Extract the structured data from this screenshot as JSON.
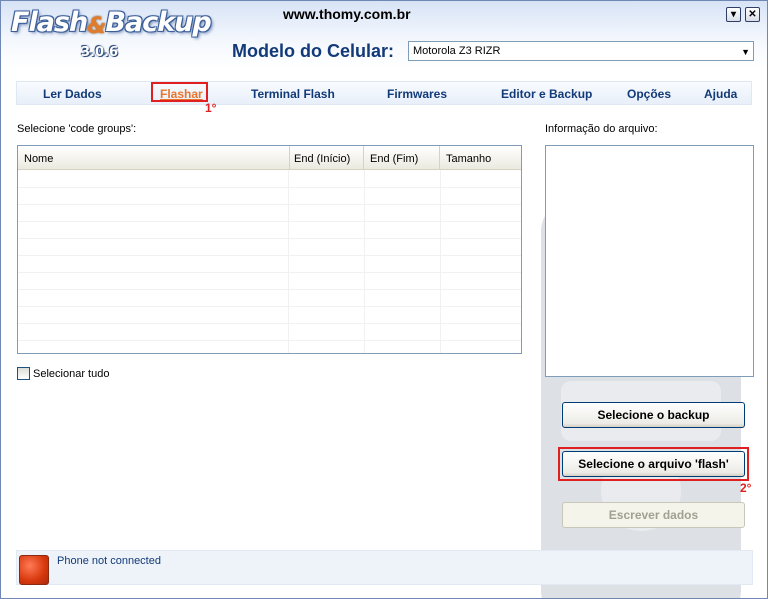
{
  "app": {
    "logo_text": "Flash&Backup",
    "version": "3.0.6",
    "site_url": "www.thomy.com.br"
  },
  "window_controls": {
    "minimize": "▾",
    "close": "✕"
  },
  "model": {
    "label": "Modelo do Celular:",
    "selected": "Motorola Z3 RIZR"
  },
  "tabs": [
    {
      "label": "Ler Dados",
      "active": false
    },
    {
      "label": "Flashar",
      "active": true
    },
    {
      "label": "Terminal Flash",
      "active": false
    },
    {
      "label": "Firmwares",
      "active": false
    },
    {
      "label": "Editor e Backup",
      "active": false
    },
    {
      "label": "Opções",
      "active": false
    },
    {
      "label": "Ajuda",
      "active": false
    }
  ],
  "annotations": {
    "step1": "1°",
    "step2": "2°",
    "color": "#e02020"
  },
  "code_groups": {
    "label": "Selecione 'code groups':",
    "columns": [
      "Nome",
      "End (Início)",
      "End (Fim)",
      "Tamanho"
    ],
    "rows": []
  },
  "select_all": {
    "label": "Selecionar tudo",
    "checked": false
  },
  "file_info": {
    "label": "Informação do arquivo:"
  },
  "buttons": {
    "select_backup": "Selecione o backup",
    "select_flash": "Selecione o arquivo 'flash'",
    "write_data": "Escrever dados"
  },
  "status": {
    "text": "Phone not connected",
    "indicator_color": "#d7380d"
  },
  "colors": {
    "accent": "#123a78",
    "active_tab": "#e9742a"
  }
}
